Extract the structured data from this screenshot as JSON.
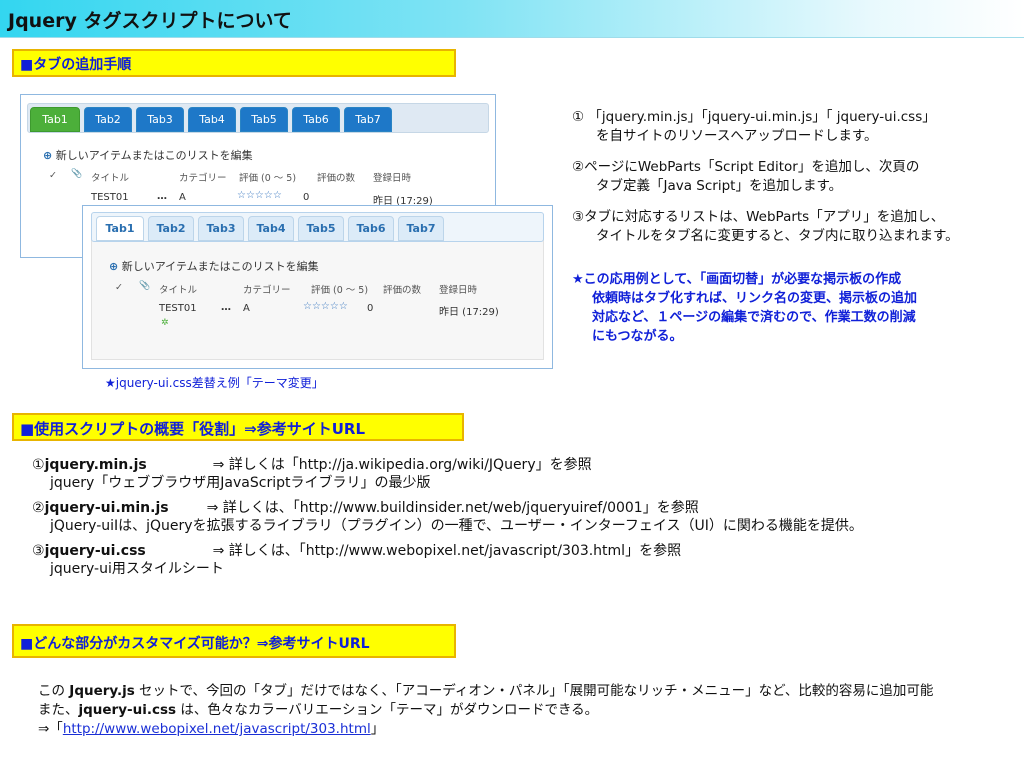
{
  "title": "Jquery タグスクリプトについて",
  "sections": {
    "s1": "■タブの追加手順",
    "s2": "■使用スクリプトの概要「役割」⇒参考サイトURL",
    "s3": "■どんな部分がカスタマイズ可能か？⇒参考サイトURL"
  },
  "mock": {
    "tabs": [
      "Tab1",
      "Tab2",
      "Tab3",
      "Tab4",
      "Tab5",
      "Tab6",
      "Tab7"
    ],
    "new_item": "新しいアイテムまたはこのリストを編集",
    "headers": {
      "check": "✓",
      "clip": "📎",
      "title": "タイトル",
      "category": "カテゴリー",
      "rating": "評価 (0 〜 5)",
      "count": "評価の数",
      "date": "登録日時"
    },
    "row": {
      "title": "TEST01",
      "dots": "…",
      "category": "A",
      "stars": "☆☆☆☆☆",
      "count": "0",
      "date": "昨日 (17:29)"
    },
    "new_badge": "✲"
  },
  "caption": "★jquery-ui.css差替え例「テーマ変更」",
  "steps": {
    "s1a": "① 「jquery.min.js」「jquery-ui.min.js」「 jquery-ui.css」",
    "s1b": "を自サイトのリソースへアップロードします。",
    "s2a": "②ページにWebParts「Script Editor」を追加し、次頁の",
    "s2b": "タブ定義「Java Script」を追加します。",
    "s3a": "③タブに対応するリストは、WebParts「アプリ」を追加し、",
    "s3b": "タイトルをタブ名に変更すると、タブ内に取り込まれます。"
  },
  "note": {
    "l1": "★この応用例として、「画面切替」が必要な掲示板の作成",
    "l2": "依頼時はタブ化すれば、リンク名の変更、掲示板の追加",
    "l3": "対応など、１ページの編集で済むので、作業工数の削減",
    "l4": "にもつながる。"
  },
  "overview": {
    "i1": {
      "num": "①",
      "name": "jquery.min.js",
      "ref": "⇒ 詳しくは「http://ja.wikipedia.org/wiki/JQuery」を参照",
      "desc": "jquery「ウェブブラウザ用JavaScriptライブラリ」の最少版"
    },
    "i2": {
      "num": "②",
      "name": "jquery-ui.min.js",
      "ref": "⇒ 詳しくは、「http://www.buildinsider.net/web/jqueryuiref/0001」を参照",
      "desc": "jQuery-uiIは、jQueryを拡張するライブラリ（プラグイン）の一種で、ユーザー・インターフェイス（UI）に関わる機能を提供。"
    },
    "i3": {
      "num": "③",
      "name": "jquery-ui.css",
      "ref": "⇒ 詳しくは、「http://www.webopixel.net/javascript/303.html」を参照",
      "desc": "jquery-ui用スタイルシート"
    }
  },
  "bottom": {
    "l1_pre": "この ",
    "l1_bold": "Jquery.js",
    "l1_post": " セットで、今回の「タブ」だけではなく、「アコーディオン・パネル」「展開可能なリッチ・メニュー」など、比較的容易に追加可能",
    "l2_pre": "また、",
    "l2_bold": "jquery-ui.css",
    "l2_post": "  は、色々なカラーバリエーション「テーマ」がダウンロードできる。",
    "l3_pre": "⇒「",
    "link": "http://www.webopixel.net/javascript/303.html",
    "l3_post": "」"
  }
}
